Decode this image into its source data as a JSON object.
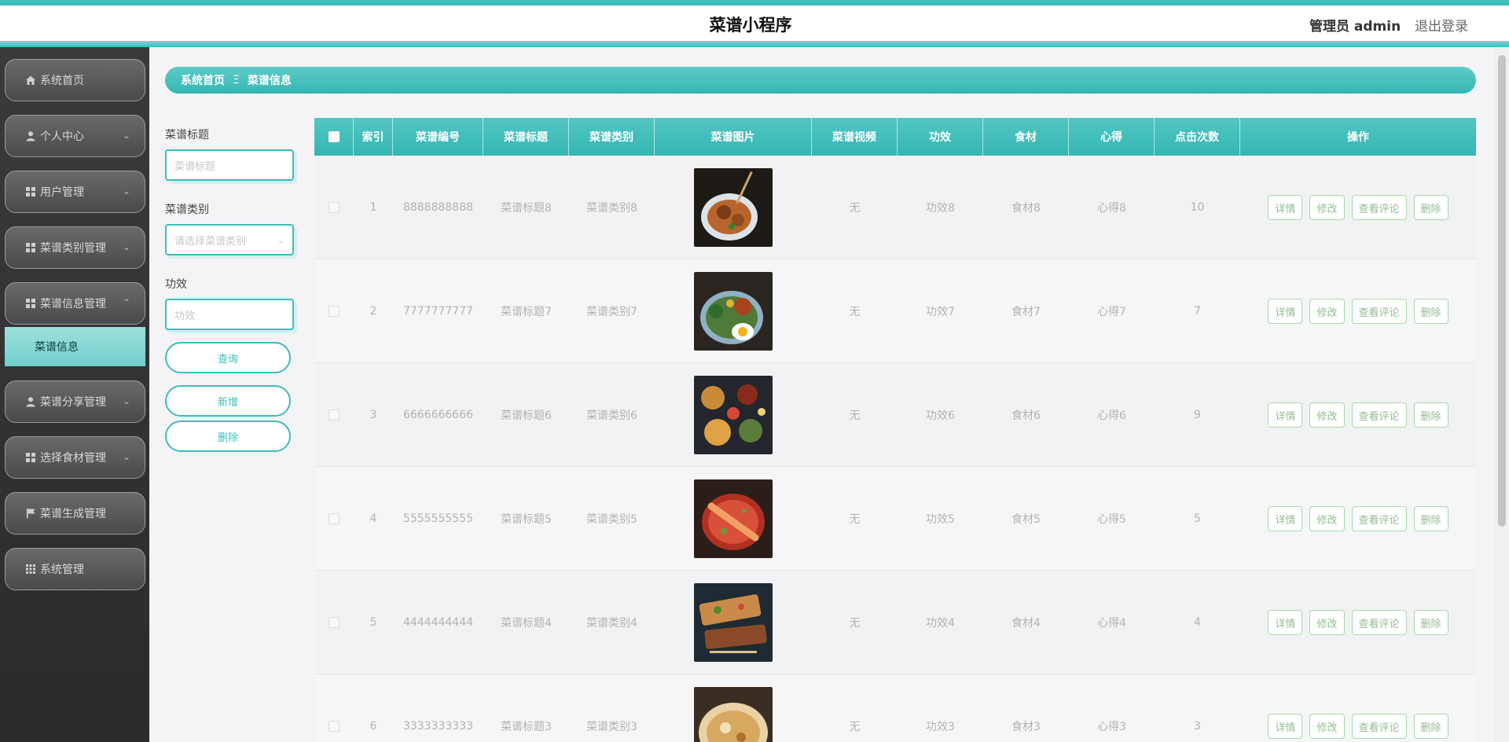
{
  "header": {
    "app_title": "菜谱小程序",
    "user_label": "管理员 admin",
    "logout_label": "退出登录"
  },
  "colors": {
    "accent": "#3dbdbb",
    "sidebar": "#3a3a3c",
    "op_button": "#93bd93"
  },
  "sidebar": {
    "items": [
      {
        "label": "系统首页",
        "icon": "home-icon"
      },
      {
        "label": "个人中心",
        "icon": "person-icon"
      },
      {
        "label": "用户管理",
        "icon": "grid-icon"
      },
      {
        "label": "菜谱类别管理",
        "icon": "grid-icon"
      },
      {
        "label": "菜谱信息管理",
        "icon": "grid-icon"
      },
      {
        "label": "菜谱分享管理",
        "icon": "person-icon"
      },
      {
        "label": "选择食材管理",
        "icon": "grid-icon"
      },
      {
        "label": "菜谱生成管理",
        "icon": "flag-icon"
      },
      {
        "label": "系统管理",
        "icon": "apps-icon"
      }
    ],
    "active_sub": "菜谱信息"
  },
  "breadcrumb": {
    "home": "系统首页",
    "separator": "Ξ",
    "current": "菜谱信息"
  },
  "search": {
    "title_label": "菜谱标题",
    "title_placeholder": "菜谱标题",
    "category_label": "菜谱类别",
    "category_placeholder": "请选择菜谱类别",
    "effect_label": "功效",
    "effect_placeholder": "功效",
    "query_button": "查询",
    "add_button": "新增",
    "delete_button": "删除"
  },
  "table": {
    "headers": [
      "索引",
      "菜谱编号",
      "菜谱标题",
      "菜谱类别",
      "菜谱图片",
      "菜谱视频",
      "功效",
      "食材",
      "心得",
      "点击次数",
      "操作"
    ],
    "ops": [
      "详情",
      "修改",
      "查看评论",
      "删除"
    ],
    "rows": [
      {
        "index": "1",
        "code": "8888888888",
        "title": "菜谱标题8",
        "category": "菜谱类别8",
        "video": "无",
        "effect": "功效8",
        "ingredient": "食材8",
        "note": "心得8",
        "clicks": "10"
      },
      {
        "index": "2",
        "code": "7777777777",
        "title": "菜谱标题7",
        "category": "菜谱类别7",
        "video": "无",
        "effect": "功效7",
        "ingredient": "食材7",
        "note": "心得7",
        "clicks": "7"
      },
      {
        "index": "3",
        "code": "6666666666",
        "title": "菜谱标题6",
        "category": "菜谱类别6",
        "video": "无",
        "effect": "功效6",
        "ingredient": "食材6",
        "note": "心得6",
        "clicks": "9"
      },
      {
        "index": "4",
        "code": "5555555555",
        "title": "菜谱标题5",
        "category": "菜谱类别5",
        "video": "无",
        "effect": "功效5",
        "ingredient": "食材5",
        "note": "心得5",
        "clicks": "5"
      },
      {
        "index": "5",
        "code": "4444444444",
        "title": "菜谱标题4",
        "category": "菜谱类别4",
        "video": "无",
        "effect": "功效4",
        "ingredient": "食材4",
        "note": "心得4",
        "clicks": "4"
      },
      {
        "index": "6",
        "code": "3333333333",
        "title": "菜谱标题3",
        "category": "菜谱类别3",
        "video": "无",
        "effect": "功效3",
        "ingredient": "食材3",
        "note": "心得3",
        "clicks": "3"
      }
    ]
  }
}
